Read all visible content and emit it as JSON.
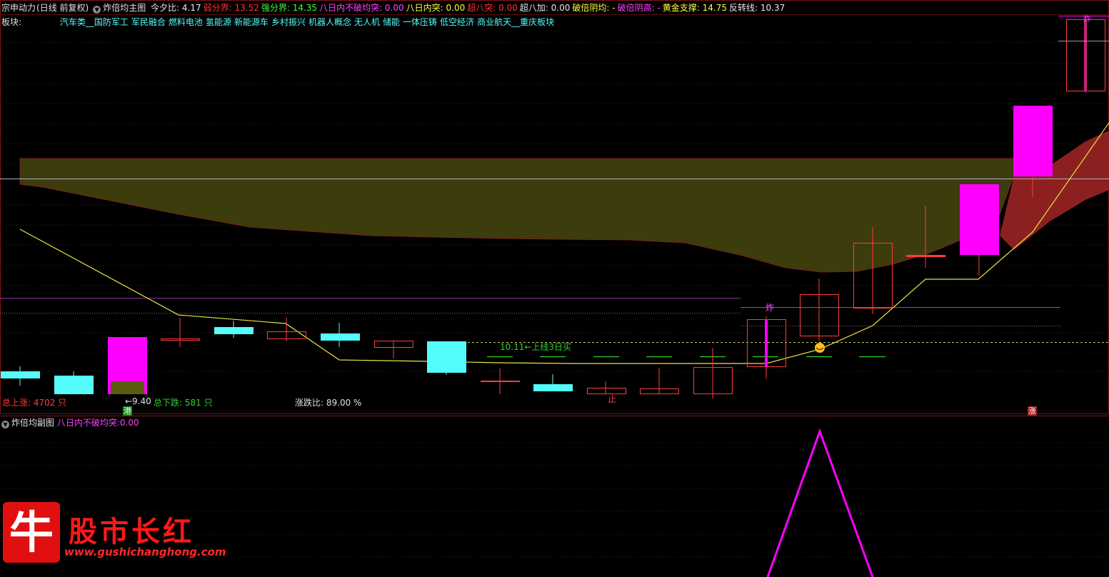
{
  "header": {
    "stock": "宗申动力",
    "period": "(日线 前复权)",
    "indicator": "炸倍均主图",
    "items": [
      {
        "label": "今夕比:",
        "value": "4.17",
        "color": "#e8e8e8"
      },
      {
        "label": "弱分界:",
        "value": "13.52",
        "color": "#ff3030"
      },
      {
        "label": "强分界:",
        "value": "14.35",
        "color": "#40ff40"
      },
      {
        "label": "八日内不破均突:",
        "value": "0.00",
        "color": "#ff40ff"
      },
      {
        "label": "八日内突:",
        "value": "0.00",
        "color": "#ffff40"
      },
      {
        "label": "超八突:",
        "value": "0.00",
        "color": "#ff3030"
      },
      {
        "label": "超八加:",
        "value": "0.00",
        "color": "#e8e8e8"
      },
      {
        "label": "破倍阴均:",
        "value": "-",
        "color": "#ffff40"
      },
      {
        "label": "破倍阴高:",
        "value": "-",
        "color": "#ff40ff"
      },
      {
        "label": "黄金支撑:",
        "value": "14.75",
        "color": "#ffff40"
      },
      {
        "label": "反转线:",
        "value": "10.37",
        "color": "#e8e8e8"
      }
    ]
  },
  "boards": {
    "label": "板块:",
    "items": [
      "汽车类",
      "国防军工",
      "军民融合",
      "燃料电池",
      "氢能源",
      "新能源车",
      "乡村振兴",
      "机器人概念",
      "无人机",
      "储能",
      "一体压铸",
      "低空经济",
      "商业航天",
      "重庆板块"
    ]
  },
  "annotations": {
    "signal": "10.11←上线3日买",
    "zha": "炸",
    "zhi": "止",
    "gang": "港",
    "low": "←9.40",
    "zhang": "涨"
  },
  "stats": {
    "up": "总上涨: 4702 只",
    "down": "总下跌: 581 只",
    "ratio": "涨跌比: 89.00 %"
  },
  "sub": {
    "indicator": "炸倍均副图",
    "label": "八日内不破均突:",
    "value": "0.00"
  },
  "logo": {
    "char": "牛",
    "title": "股市长红",
    "url": "www.gushichanghong.com"
  },
  "colors": {
    "up": "#ff3c3c",
    "down": "#54fcfc",
    "magenta": "#ff00ff",
    "band_olive": "#3c3c0c",
    "band_red": "#8c2020",
    "yellow_line": "#e6e640"
  }
}
